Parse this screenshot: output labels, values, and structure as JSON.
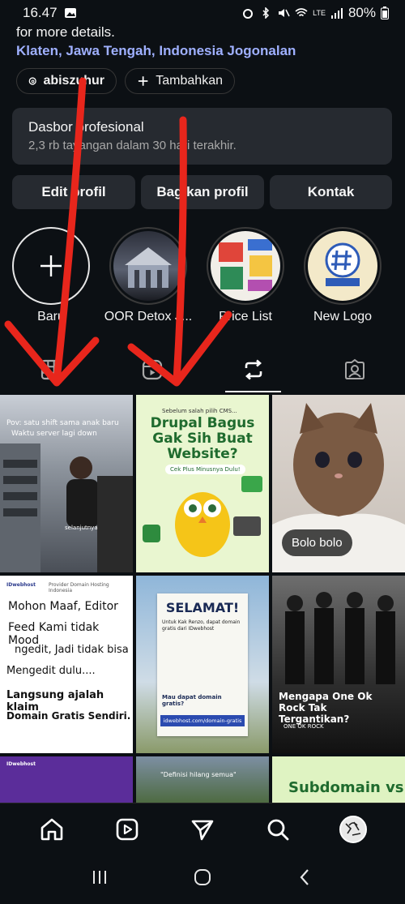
{
  "status": {
    "time": "16.47",
    "battery": "80%",
    "network": "LTE"
  },
  "bio": {
    "text": "for more details.",
    "location": "Klaten, Jawa Tengah, Indonesia Jogonalan"
  },
  "chips": {
    "threads": "abiszuhur",
    "add": "Tambahkan"
  },
  "dashboard": {
    "title": "Dasbor profesional",
    "subtitle": "2,3 rb tayangan dalam 30 hari terakhir."
  },
  "buttons": {
    "edit": "Edit profil",
    "share": "Bagikan profil",
    "contact": "Kontak"
  },
  "highlights": [
    {
      "label": "Baru"
    },
    {
      "label": "OOR Detox J..."
    },
    {
      "label": "Price List"
    },
    {
      "label": "New Logo"
    }
  ],
  "tabs": [
    {
      "icon": "grid-icon"
    },
    {
      "icon": "reels-icon"
    },
    {
      "icon": "repost-icon"
    },
    {
      "icon": "tagged-icon"
    }
  ],
  "posts": {
    "p1": {
      "top": "Pov: satu shift sama anak baru",
      "bottom": "Waktu server lagi down",
      "caption": "selanjutnya"
    },
    "p2": {
      "pre": "Sebelum salah pilih CMS...",
      "headline": "Drupal Bagus Gak Sih Buat Website?",
      "cta": "Cek Plus Minusnya Dulu!"
    },
    "p3": {
      "pill": "Bolo bolo"
    },
    "p4": {
      "brand": "IDwebhost",
      "tagline": "Provider Domain Hosting Indonesia",
      "line1": "Mohon Maaf, Editor",
      "line2": "Feed Kami tidak Mood",
      "line3": "ngedit, Jadi tidak bisa",
      "line4": "Mengedit dulu....",
      "line5": "Langsung ajalah klaim",
      "line6": "Domain Gratis Sendiri."
    },
    "p5": {
      "headline": "SELAMAT!",
      "sub": "Untuk Kak Renzo, dapat domain gratis dari IDwebhost",
      "q": "Mau dapat domain gratis?",
      "url": "idwebhost.com/domain-gratis"
    },
    "p6": {
      "headline": "Mengapa One Ok Rock Tak Tergantikan?",
      "tag": "ONE OK ROCK"
    },
    "p7": {
      "brand": "IDwebhost"
    },
    "p8": {
      "quote": "\"Definisi hilang semua\""
    },
    "p9": {
      "headline": "Subdomain vs"
    }
  },
  "colors": {
    "accent": "#9fb0ff",
    "surface": "#262a30",
    "bg": "#0c1014",
    "arrow": "#e8261c"
  }
}
